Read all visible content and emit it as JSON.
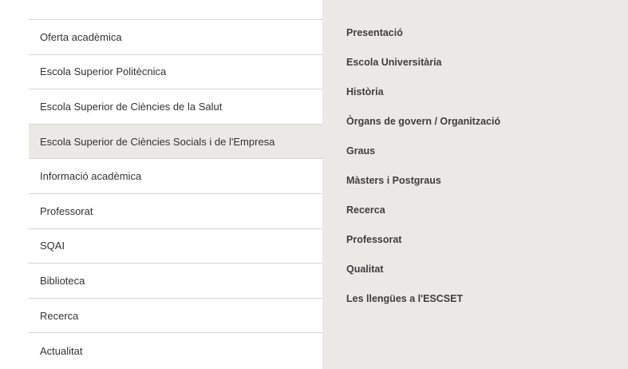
{
  "left_menu": {
    "items": [
      {
        "label": "Oferta acadèmica"
      },
      {
        "label": "Escola Superior Politècnica"
      },
      {
        "label": "Escola Superior de Ciències de la Salut"
      },
      {
        "label": "Escola Superior de Ciències Socials i de l'Empresa"
      },
      {
        "label": "Informació acadèmica"
      },
      {
        "label": "Professorat"
      },
      {
        "label": "SQAI"
      },
      {
        "label": "Biblioteca"
      },
      {
        "label": "Recerca"
      },
      {
        "label": "Actualitat"
      }
    ],
    "active_item": "Escola Superior de Ciències Socials i de l'Empresa"
  },
  "right_menu": {
    "items": [
      {
        "label": "Presentació"
      },
      {
        "label": "Escola Universitària"
      },
      {
        "label": "Història"
      },
      {
        "label": "Òrgans de govern / Organització"
      },
      {
        "label": "Graus"
      },
      {
        "label": "Màsters i Postgraus"
      },
      {
        "label": "Recerca"
      },
      {
        "label": "Professorat"
      },
      {
        "label": "Qualitat"
      },
      {
        "label": "Les llengües a l'ESCSET"
      }
    ]
  },
  "colors": {
    "active_background": "#ebe9e5",
    "submenu_background": "#ebe9e5",
    "divider": "#d8d6d2",
    "text": "#333333"
  }
}
